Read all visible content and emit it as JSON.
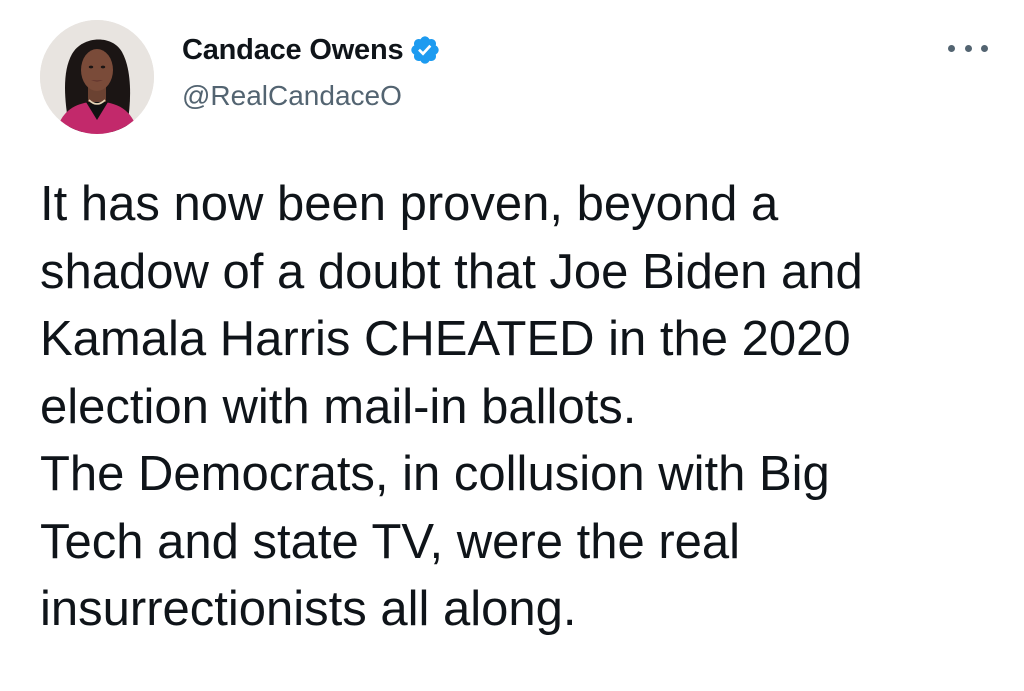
{
  "author": {
    "display_name": "Candace Owens",
    "handle": "@RealCandaceO",
    "verified": true,
    "avatar_icon": "profile-photo",
    "verified_icon": "verified-badge-icon"
  },
  "actions": {
    "more_icon": "more-options-icon"
  },
  "tweet": {
    "lines": [
      "It has now been proven, beyond a",
      "shadow of a doubt that Joe Biden and",
      "Kamala Harris CHEATED in the 2020",
      "election with mail-in ballots.",
      "The Democrats, in collusion with Big",
      "Tech and state TV, were the real",
      "insurrectionists all along."
    ]
  },
  "colors": {
    "text": "#0f1419",
    "secondary": "#536471",
    "verified": "#1d9bf0",
    "background": "#ffffff"
  }
}
